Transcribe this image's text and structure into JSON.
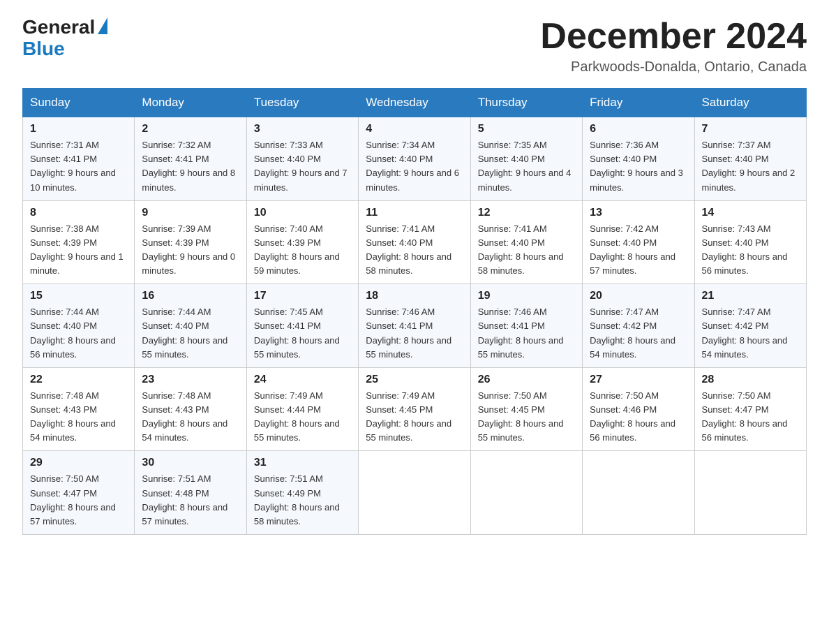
{
  "header": {
    "logo_general": "General",
    "logo_blue": "Blue",
    "month_title": "December 2024",
    "location": "Parkwoods-Donalda, Ontario, Canada"
  },
  "days_of_week": [
    "Sunday",
    "Monday",
    "Tuesday",
    "Wednesday",
    "Thursday",
    "Friday",
    "Saturday"
  ],
  "weeks": [
    [
      {
        "day": "1",
        "sunrise": "7:31 AM",
        "sunset": "4:41 PM",
        "daylight": "9 hours and 10 minutes."
      },
      {
        "day": "2",
        "sunrise": "7:32 AM",
        "sunset": "4:41 PM",
        "daylight": "9 hours and 8 minutes."
      },
      {
        "day": "3",
        "sunrise": "7:33 AM",
        "sunset": "4:40 PM",
        "daylight": "9 hours and 7 minutes."
      },
      {
        "day": "4",
        "sunrise": "7:34 AM",
        "sunset": "4:40 PM",
        "daylight": "9 hours and 6 minutes."
      },
      {
        "day": "5",
        "sunrise": "7:35 AM",
        "sunset": "4:40 PM",
        "daylight": "9 hours and 4 minutes."
      },
      {
        "day": "6",
        "sunrise": "7:36 AM",
        "sunset": "4:40 PM",
        "daylight": "9 hours and 3 minutes."
      },
      {
        "day": "7",
        "sunrise": "7:37 AM",
        "sunset": "4:40 PM",
        "daylight": "9 hours and 2 minutes."
      }
    ],
    [
      {
        "day": "8",
        "sunrise": "7:38 AM",
        "sunset": "4:39 PM",
        "daylight": "9 hours and 1 minute."
      },
      {
        "day": "9",
        "sunrise": "7:39 AM",
        "sunset": "4:39 PM",
        "daylight": "9 hours and 0 minutes."
      },
      {
        "day": "10",
        "sunrise": "7:40 AM",
        "sunset": "4:39 PM",
        "daylight": "8 hours and 59 minutes."
      },
      {
        "day": "11",
        "sunrise": "7:41 AM",
        "sunset": "4:40 PM",
        "daylight": "8 hours and 58 minutes."
      },
      {
        "day": "12",
        "sunrise": "7:41 AM",
        "sunset": "4:40 PM",
        "daylight": "8 hours and 58 minutes."
      },
      {
        "day": "13",
        "sunrise": "7:42 AM",
        "sunset": "4:40 PM",
        "daylight": "8 hours and 57 minutes."
      },
      {
        "day": "14",
        "sunrise": "7:43 AM",
        "sunset": "4:40 PM",
        "daylight": "8 hours and 56 minutes."
      }
    ],
    [
      {
        "day": "15",
        "sunrise": "7:44 AM",
        "sunset": "4:40 PM",
        "daylight": "8 hours and 56 minutes."
      },
      {
        "day": "16",
        "sunrise": "7:44 AM",
        "sunset": "4:40 PM",
        "daylight": "8 hours and 55 minutes."
      },
      {
        "day": "17",
        "sunrise": "7:45 AM",
        "sunset": "4:41 PM",
        "daylight": "8 hours and 55 minutes."
      },
      {
        "day": "18",
        "sunrise": "7:46 AM",
        "sunset": "4:41 PM",
        "daylight": "8 hours and 55 minutes."
      },
      {
        "day": "19",
        "sunrise": "7:46 AM",
        "sunset": "4:41 PM",
        "daylight": "8 hours and 55 minutes."
      },
      {
        "day": "20",
        "sunrise": "7:47 AM",
        "sunset": "4:42 PM",
        "daylight": "8 hours and 54 minutes."
      },
      {
        "day": "21",
        "sunrise": "7:47 AM",
        "sunset": "4:42 PM",
        "daylight": "8 hours and 54 minutes."
      }
    ],
    [
      {
        "day": "22",
        "sunrise": "7:48 AM",
        "sunset": "4:43 PM",
        "daylight": "8 hours and 54 minutes."
      },
      {
        "day": "23",
        "sunrise": "7:48 AM",
        "sunset": "4:43 PM",
        "daylight": "8 hours and 54 minutes."
      },
      {
        "day": "24",
        "sunrise": "7:49 AM",
        "sunset": "4:44 PM",
        "daylight": "8 hours and 55 minutes."
      },
      {
        "day": "25",
        "sunrise": "7:49 AM",
        "sunset": "4:45 PM",
        "daylight": "8 hours and 55 minutes."
      },
      {
        "day": "26",
        "sunrise": "7:50 AM",
        "sunset": "4:45 PM",
        "daylight": "8 hours and 55 minutes."
      },
      {
        "day": "27",
        "sunrise": "7:50 AM",
        "sunset": "4:46 PM",
        "daylight": "8 hours and 56 minutes."
      },
      {
        "day": "28",
        "sunrise": "7:50 AM",
        "sunset": "4:47 PM",
        "daylight": "8 hours and 56 minutes."
      }
    ],
    [
      {
        "day": "29",
        "sunrise": "7:50 AM",
        "sunset": "4:47 PM",
        "daylight": "8 hours and 57 minutes."
      },
      {
        "day": "30",
        "sunrise": "7:51 AM",
        "sunset": "4:48 PM",
        "daylight": "8 hours and 57 minutes."
      },
      {
        "day": "31",
        "sunrise": "7:51 AM",
        "sunset": "4:49 PM",
        "daylight": "8 hours and 58 minutes."
      },
      null,
      null,
      null,
      null
    ]
  ]
}
